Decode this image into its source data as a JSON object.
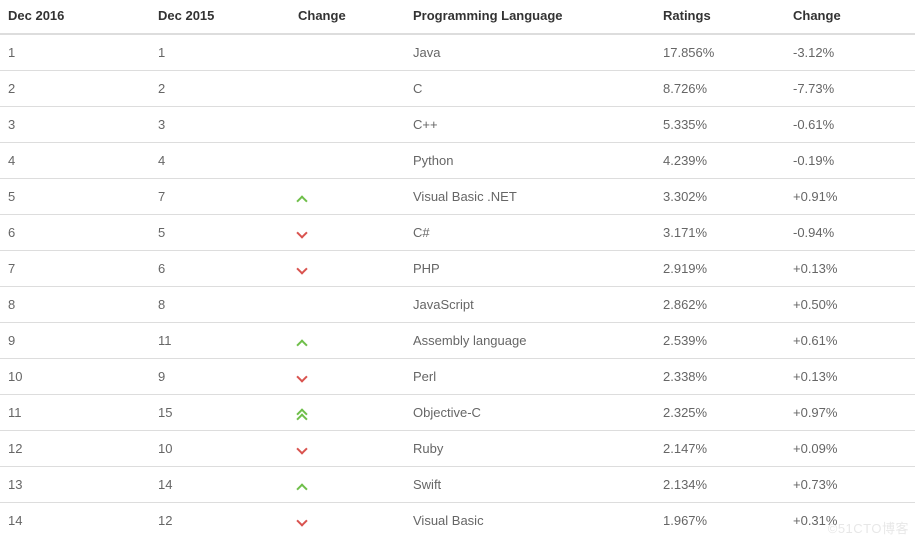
{
  "headers": {
    "dec2016": "Dec 2016",
    "dec2015": "Dec 2015",
    "change1": "Change",
    "lang": "Programming Language",
    "ratings": "Ratings",
    "change2": "Change"
  },
  "rows": [
    {
      "dec2016": "1",
      "dec2015": "1",
      "trend": "",
      "lang": "Java",
      "ratings": "17.856%",
      "change": "-3.12%"
    },
    {
      "dec2016": "2",
      "dec2015": "2",
      "trend": "",
      "lang": "C",
      "ratings": "8.726%",
      "change": "-7.73%"
    },
    {
      "dec2016": "3",
      "dec2015": "3",
      "trend": "",
      "lang": "C++",
      "ratings": "5.335%",
      "change": "-0.61%"
    },
    {
      "dec2016": "4",
      "dec2015": "4",
      "trend": "",
      "lang": "Python",
      "ratings": "4.239%",
      "change": "-0.19%"
    },
    {
      "dec2016": "5",
      "dec2015": "7",
      "trend": "up",
      "lang": "Visual Basic .NET",
      "ratings": "3.302%",
      "change": "+0.91%"
    },
    {
      "dec2016": "6",
      "dec2015": "5",
      "trend": "down",
      "lang": "C#",
      "ratings": "3.171%",
      "change": "-0.94%"
    },
    {
      "dec2016": "7",
      "dec2015": "6",
      "trend": "down",
      "lang": "PHP",
      "ratings": "2.919%",
      "change": "+0.13%"
    },
    {
      "dec2016": "8",
      "dec2015": "8",
      "trend": "",
      "lang": "JavaScript",
      "ratings": "2.862%",
      "change": "+0.50%"
    },
    {
      "dec2016": "9",
      "dec2015": "11",
      "trend": "up",
      "lang": "Assembly language",
      "ratings": "2.539%",
      "change": "+0.61%"
    },
    {
      "dec2016": "10",
      "dec2015": "9",
      "trend": "down",
      "lang": "Perl",
      "ratings": "2.338%",
      "change": "+0.13%"
    },
    {
      "dec2016": "11",
      "dec2015": "15",
      "trend": "up2",
      "lang": "Objective-C",
      "ratings": "2.325%",
      "change": "+0.97%"
    },
    {
      "dec2016": "12",
      "dec2015": "10",
      "trend": "down",
      "lang": "Ruby",
      "ratings": "2.147%",
      "change": "+0.09%"
    },
    {
      "dec2016": "13",
      "dec2015": "14",
      "trend": "up",
      "lang": "Swift",
      "ratings": "2.134%",
      "change": "+0.73%"
    },
    {
      "dec2016": "14",
      "dec2015": "12",
      "trend": "down",
      "lang": "Visual Basic",
      "ratings": "1.967%",
      "change": "+0.31%"
    }
  ],
  "watermark": "©51CTO博客"
}
